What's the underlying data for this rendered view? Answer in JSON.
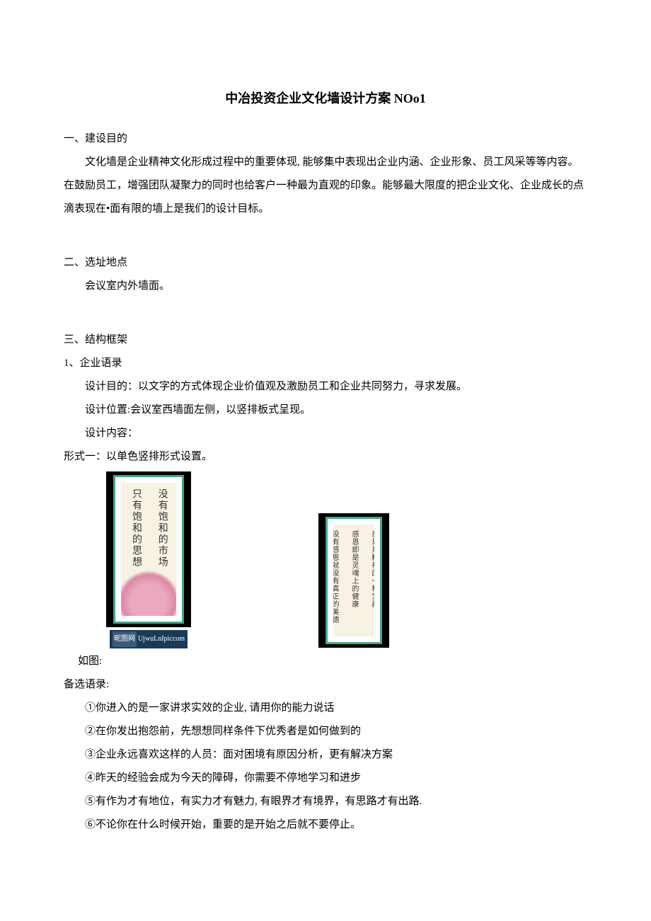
{
  "title": "中冶投资企业文化墙设计方案 NOo1",
  "section1": {
    "head": "一、建设目的",
    "body": "文化墙是企业精神文化形成过程中的重要体现, 能够集中表现出企业内涵、企业形象、员工风采等等内容。在鼓励员工，增强团队凝聚力的同时也给客户一种最为直观的印象。能够最大限度的把企业文化、企业成长的点滴表现在•面有限的墙上是我们的设计目标。"
  },
  "section2": {
    "head": "二、选址地点",
    "body": "会议室内外墙面。"
  },
  "section3": {
    "head": "三、结构框架",
    "item1": {
      "head": "1、企业语录",
      "purpose_label": "设计目的：",
      "purpose": "以文字的方式体现企业价值观及激励员工和企业共同努力，寻求发展。",
      "loc_label": "设计位置:",
      "loc": "会议室西墙面左侧，以竖排板式呈现。",
      "content_label": "设计内容：",
      "form1": "形式一：以单色竖排形式设置。",
      "fig_label": "如图:",
      "scroll_left_a": "没有饱和的市场",
      "scroll_left_b": "只有饱和的思想",
      "scroll_right_a": "感恩是精神的一种宝藏",
      "scroll_right_b": "感恩即是灵魂上的健康",
      "scroll_right_c": "没有感恩就没有真正的美德",
      "watermark_logo": "昵图网",
      "watermark_text": "UjwuLnIpiccom",
      "alt_head": "备选语录:",
      "quotes": {
        "q1": "①你进入的是一家讲求实效的企业, 请用你的能力说话",
        "q2": "②在你发出抱怨前，先想想同样条件下优秀者是如何做到的",
        "q3": "③企业永远喜欢这样的人员：面对困境有原因分析，更有解决方案",
        "q4": "④昨天的经验会成为今天的障碍，你需要不停地学习和进步",
        "q5": "⑤有作为才有地位，有实力才有魅力, 有眼界才有境界，有思路才有出路.",
        "q6": "⑥不论你在什么时候开始，重要的是开始之后就不要停止。"
      }
    }
  }
}
